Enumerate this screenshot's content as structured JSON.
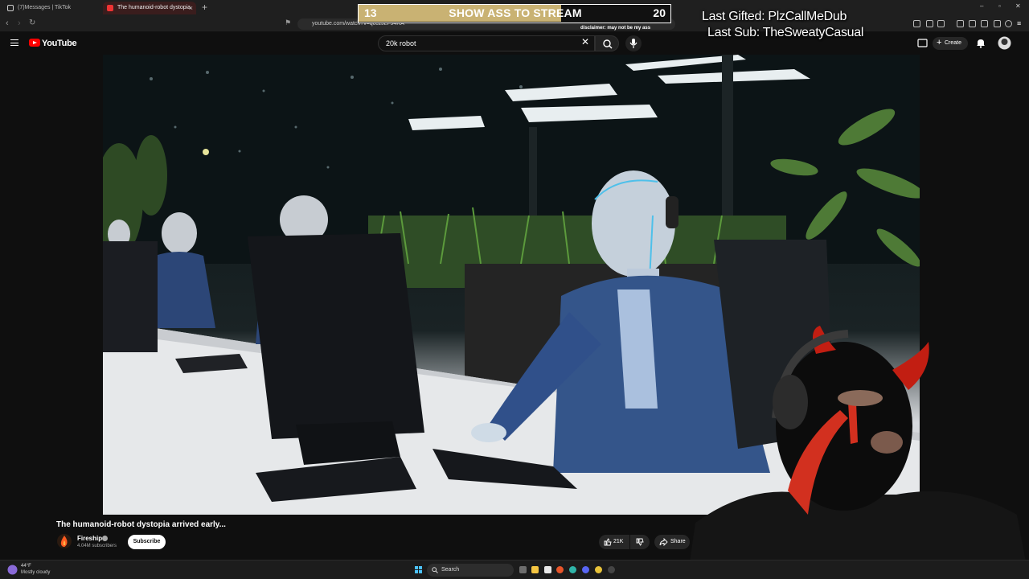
{
  "browser": {
    "tabs": [
      {
        "title": "(7)Messages | TikTok",
        "active": false
      },
      {
        "title": "The humanoid-robot dystopia",
        "active": true
      }
    ],
    "url": "youtube.com/watch?v=qcczJLFJ4RA"
  },
  "youtube": {
    "logo_text": "YouTube",
    "search": {
      "value": "20k robot"
    },
    "create_label": "Create"
  },
  "video": {
    "title": "The humanoid-robot dystopia arrived early...",
    "channel": "Fireship",
    "subscribers": "4.04M subscribers",
    "subscribe_label": "Subscribe",
    "likes": "21K",
    "share_label": "Share"
  },
  "overlay": {
    "goal": {
      "current": 13,
      "target": 20,
      "label": "SHOW ASS TO STREAM"
    },
    "disclaimer": "disclaimer: may not be my ass",
    "last_gifted": "Last Gifted: PlzCallMeDub",
    "last_sub": "Last Sub: TheSweatyCasual"
  },
  "taskbar": {
    "weather_temp": "44°F",
    "weather_desc": "Mostly cloudy",
    "search_label": "Search"
  },
  "colors": {
    "yt_red": "#ff0000",
    "goal_fill": "#c9b273",
    "background": "#0f0f0f"
  }
}
